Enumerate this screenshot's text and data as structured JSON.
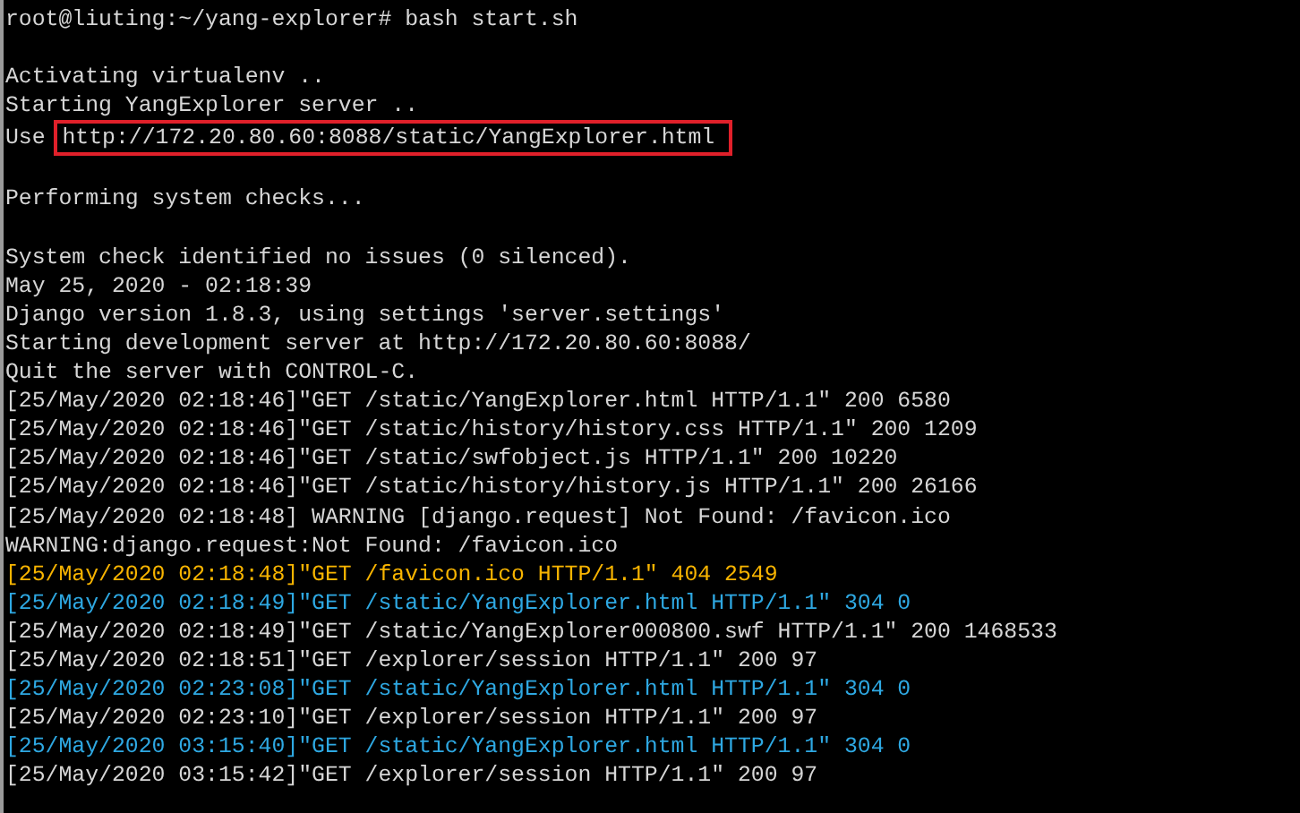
{
  "terminal": {
    "lines": [
      {
        "kind": "normal",
        "text": "root@liuting:~/yang-explorer# bash start.sh"
      },
      {
        "kind": "blank"
      },
      {
        "kind": "normal",
        "text": "Activating virtualenv .."
      },
      {
        "kind": "normal",
        "text": "Starting YangExplorer server .."
      },
      {
        "kind": "boxed",
        "text": "Use",
        "link": "http://172.20.80.60:8088/static/YangExplorer.html"
      },
      {
        "kind": "blank"
      },
      {
        "kind": "normal",
        "text": "Performing system checks..."
      },
      {
        "kind": "blank"
      },
      {
        "kind": "normal",
        "text": "System check identified no issues (0 silenced)."
      },
      {
        "kind": "normal",
        "text": "May 25, 2020 - 02:18:39"
      },
      {
        "kind": "normal",
        "text": "Django version 1.8.3, using settings 'server.settings'"
      },
      {
        "kind": "normal",
        "text": "Starting development server at http://172.20.80.60:8088/"
      },
      {
        "kind": "normal",
        "text": "Quit the server with CONTROL-C."
      },
      {
        "kind": "normal",
        "text": "[25/May/2020 02:18:46]\"GET /static/YangExplorer.html HTTP/1.1\" 200 6580"
      },
      {
        "kind": "normal",
        "text": "[25/May/2020 02:18:46]\"GET /static/history/history.css HTTP/1.1\" 200 1209"
      },
      {
        "kind": "normal",
        "text": "[25/May/2020 02:18:46]\"GET /static/swfobject.js HTTP/1.1\" 200 10220"
      },
      {
        "kind": "normal",
        "text": "[25/May/2020 02:18:46]\"GET /static/history/history.js HTTP/1.1\" 200 26166"
      },
      {
        "kind": "normal",
        "text": "[25/May/2020 02:18:48] WARNING [django.request] Not Found: /favicon.ico"
      },
      {
        "kind": "normal",
        "text": "WARNING:django.request:Not Found: /favicon.ico"
      },
      {
        "kind": "warning",
        "text": "[25/May/2020 02:18:48]\"GET /favicon.ico HTTP/1.1\" 404 2549"
      },
      {
        "kind": "info",
        "text": "[25/May/2020 02:18:49]\"GET /static/YangExplorer.html HTTP/1.1\" 304 0"
      },
      {
        "kind": "normal",
        "text": "[25/May/2020 02:18:49]\"GET /static/YangExplorer000800.swf HTTP/1.1\" 200 1468533"
      },
      {
        "kind": "normal",
        "text": "[25/May/2020 02:18:51]\"GET /explorer/session HTTP/1.1\" 200 97"
      },
      {
        "kind": "info",
        "text": "[25/May/2020 02:23:08]\"GET /static/YangExplorer.html HTTP/1.1\" 304 0"
      },
      {
        "kind": "normal",
        "text": "[25/May/2020 02:23:10]\"GET /explorer/session HTTP/1.1\" 200 97"
      },
      {
        "kind": "info",
        "text": "[25/May/2020 03:15:40]\"GET /static/YangExplorer.html HTTP/1.1\" 304 0"
      },
      {
        "kind": "normal",
        "text": "[25/May/2020 03:15:42]\"GET /explorer/session HTTP/1.1\" 200 97"
      }
    ]
  }
}
